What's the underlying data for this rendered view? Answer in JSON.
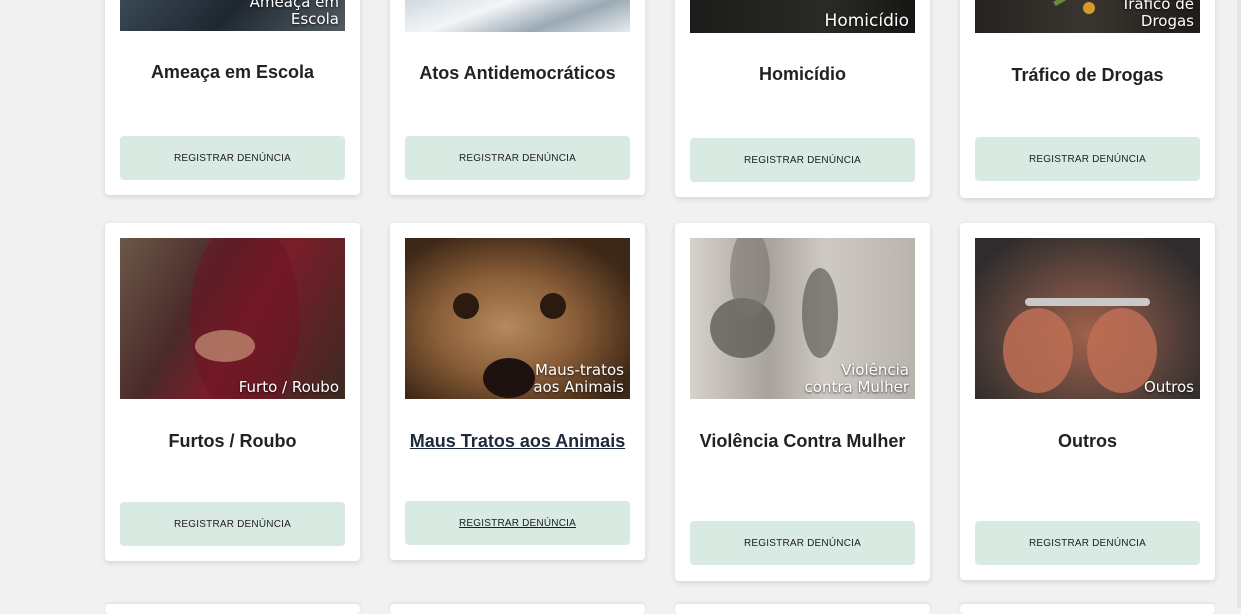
{
  "cards_row1": [
    {
      "title": "Ameaça em Escola",
      "image_caption": "Ameaça em\nEscola",
      "button_label": "REGISTRAR DENÚNCIA"
    },
    {
      "title": "Atos Antidemocráticos",
      "image_caption": "",
      "button_label": "REGISTRAR DENÚNCIA"
    },
    {
      "title": "Homicídio",
      "image_caption": "Homicídio",
      "button_label": "REGISTRAR DENÚNCIA"
    },
    {
      "title": "Tráfico de Drogas",
      "image_caption": "Tráfico de\nDrogas",
      "button_label": "REGISTRAR DENÚNCIA"
    }
  ],
  "cards_row2": [
    {
      "title": "Furtos / Roubo",
      "image_caption": "Furto / Roubo",
      "button_label": "REGISTRAR DENÚNCIA"
    },
    {
      "title": "Maus Tratos aos Animais",
      "image_caption": "Maus-tratos\naos Animais",
      "button_label": "REGISTRAR DENÚNCIA"
    },
    {
      "title": "Violência Contra Mulher",
      "image_caption": "Violência\ncontra Mulher",
      "button_label": "REGISTRAR DENÚNCIA"
    },
    {
      "title": "Outros",
      "image_caption": "Outros",
      "button_label": "REGISTRAR DENÚNCIA"
    }
  ],
  "colors": {
    "page_background": "#f1f1f1",
    "card_background": "#ffffff",
    "button_background": "#d9eae3",
    "title_text": "#222222"
  },
  "icons": {
    "image_thumbnails": "category-photo"
  }
}
